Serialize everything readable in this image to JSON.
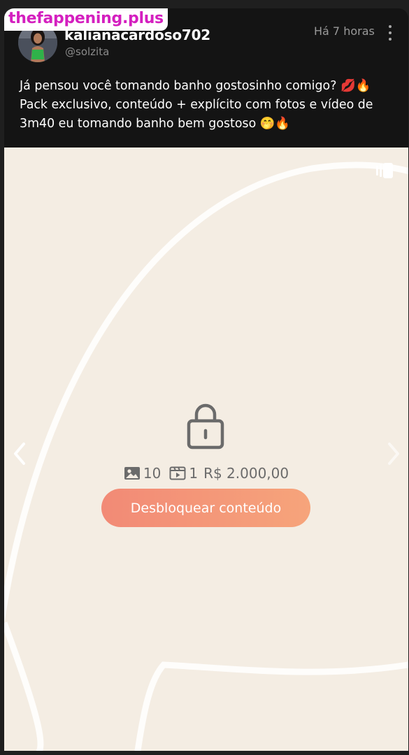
{
  "watermark": {
    "text": "thefappening.plus",
    "color": "#d41fbf"
  },
  "post": {
    "author": {
      "display_name": "kalianacardoso702",
      "handle": "@solzita"
    },
    "time": "Há 7 horas",
    "menu_icon": "more-vertical-icon",
    "caption_lines": [
      "Já pensou você tomando banho gostosinho comigo? 💋🔥",
      "Pack exclusivo, conteúdo + explícito com fotos e vídeo de",
      "3m40 eu tomando banho bem gostoso 🤭🔥"
    ]
  },
  "media": {
    "background_color": "#f4ede3",
    "locked": true,
    "photo_count": "10",
    "video_count": "1",
    "price": "R$ 2.000,00",
    "unlock_label": "Desbloquear conteúdo",
    "icons": {
      "carousel": "carousel-icon",
      "lock": "lock-icon",
      "photo": "image-icon",
      "video": "video-icon",
      "prev": "chevron-left-icon",
      "next": "chevron-right-icon"
    }
  },
  "colors": {
    "card_bg": "#141414",
    "accent_gradient_start": "#f28a76",
    "accent_gradient_end": "#f6a47b"
  }
}
